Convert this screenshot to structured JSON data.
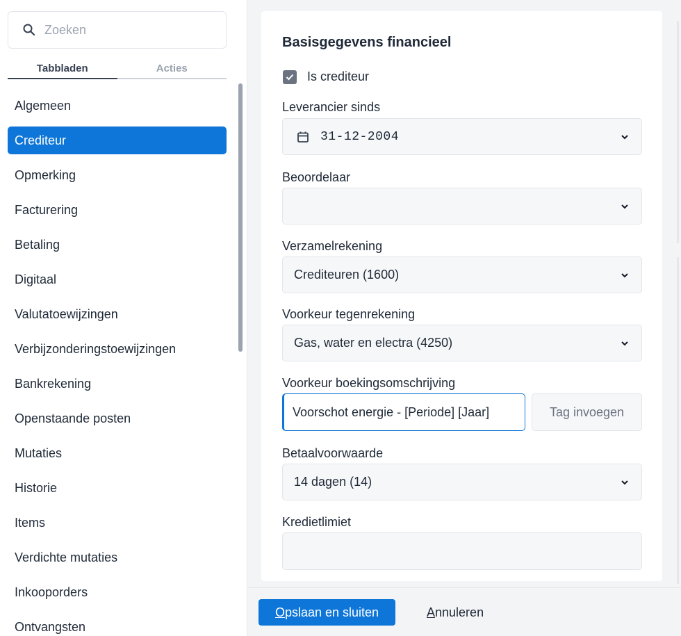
{
  "sidebar": {
    "search": {
      "placeholder": "Zoeken"
    },
    "tabs": [
      {
        "label": "Tabbladen",
        "active": true
      },
      {
        "label": "Acties",
        "active": false
      }
    ],
    "items": [
      {
        "label": "Algemeen"
      },
      {
        "label": "Crediteur",
        "active": true
      },
      {
        "label": "Opmerking"
      },
      {
        "label": "Facturering"
      },
      {
        "label": "Betaling"
      },
      {
        "label": "Digitaal"
      },
      {
        "label": "Valutatoewijzingen"
      },
      {
        "label": "Verbijzonderingstoewijzingen"
      },
      {
        "label": "Bankrekening"
      },
      {
        "label": "Openstaande posten"
      },
      {
        "label": "Mutaties"
      },
      {
        "label": "Historie"
      },
      {
        "label": "Items"
      },
      {
        "label": "Verdichte mutaties"
      },
      {
        "label": "Inkooporders"
      },
      {
        "label": "Ontvangsten"
      }
    ]
  },
  "form": {
    "title": "Basisgegevens financieel",
    "is_crediteur": {
      "label": "Is crediteur",
      "checked": true
    },
    "leverancier_sinds": {
      "label": "Leverancier sinds",
      "value": "31-12-2004"
    },
    "beoordelaar": {
      "label": "Beoordelaar",
      "value": ""
    },
    "verzamelrekening": {
      "label": "Verzamelrekening",
      "value": "Crediteuren (1600)"
    },
    "voorkeur_tegenrekening": {
      "label": "Voorkeur tegenrekening",
      "value": "Gas, water en electra (4250)"
    },
    "voorkeur_boekingsomschrijving": {
      "label": "Voorkeur boekingsomschrijving",
      "value": "Voorschot energie - [Periode] [Jaar]",
      "tag_button": "Tag invoegen"
    },
    "betaalvoorwaarde": {
      "label": "Betaalvoorwaarde",
      "value": "14 dagen (14)"
    },
    "kredietlimiet": {
      "label": "Kredietlimiet",
      "value": ""
    }
  },
  "footer": {
    "save_label": "Opslaan en sluiten",
    "cancel_label": "Annuleren"
  },
  "colors": {
    "accent": "#0e76d8",
    "checkbox": "#6b7280",
    "field_bg": "#f6f7f9"
  }
}
